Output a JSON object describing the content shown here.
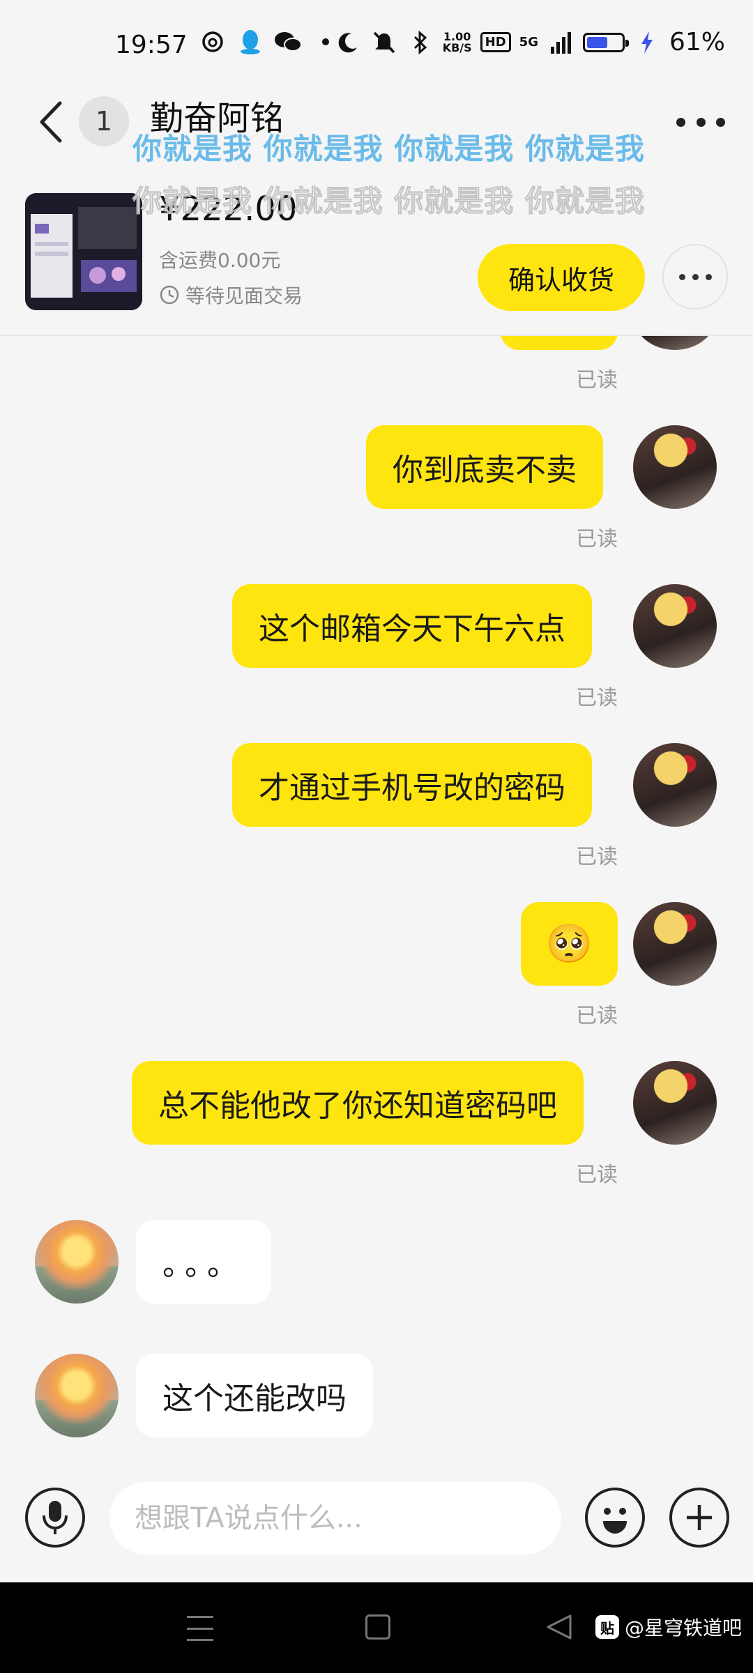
{
  "status_bar": {
    "time": "19:57",
    "net_speed_value": "1.00",
    "net_speed_unit": "KB/S",
    "hd": "HD",
    "signal": "5G",
    "battery_percent": "61%",
    "battery_level": 0.61
  },
  "header": {
    "unread_count": "1",
    "contact_name": "勤奋阿铭",
    "watermark_line1": "你就是我 你就是我 你就是我 你就是我",
    "watermark_line2": "你就是我 你就是我 你就是我 你就是我"
  },
  "product": {
    "price": "¥222.00",
    "shipping": "含运费0.00元",
    "status": "等待见面交易",
    "confirm_label": "确认收货"
  },
  "messages": {
    "read": "已读",
    "m1": "你到底卖不卖",
    "m2": "这个邮箱今天下午六点",
    "m3": "才通过手机号改的密码",
    "m4": "🥺",
    "m5": "总不能他改了你还知道密码吧",
    "r1": "。。。",
    "r2": "这个还能改吗"
  },
  "input": {
    "placeholder": "想跟TA说点什么..."
  },
  "footer": {
    "tieba_logo": "贴",
    "credit": "@星穹铁道吧"
  },
  "colors": {
    "accent_yellow": "#ffe50f",
    "background": "#f5f5f5",
    "battery_blue": "#3a54e8"
  }
}
